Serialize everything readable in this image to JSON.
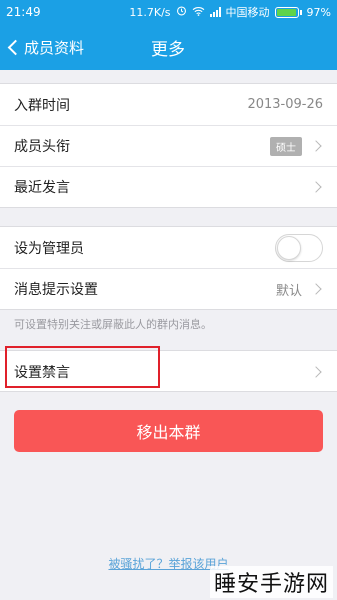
{
  "status_bar": {
    "time": "21:49",
    "speed": "11.7K/s",
    "carrier": "中国移动",
    "battery": "97%",
    "battery_level": 0.97,
    "icons": [
      "alarm-icon",
      "wifi-icon",
      "signal-icon",
      "battery-icon"
    ]
  },
  "nav": {
    "back_label": "成员资料",
    "title": "更多"
  },
  "group1": [
    {
      "label": "入群时间",
      "value": "2013-09-26"
    },
    {
      "label": "成员头衔",
      "badge": "硕士"
    },
    {
      "label": "最近发言"
    }
  ],
  "group2": [
    {
      "label": "设为管理员",
      "toggle_on": false
    },
    {
      "label": "消息提示设置",
      "value": "默认"
    }
  ],
  "hint": "可设置特别关注或屏蔽此人的群内消息。",
  "group3": [
    {
      "label": "设置禁言"
    }
  ],
  "remove_button": "移出本群",
  "report_link": "被骚扰了？举报该用户",
  "watermark": "睡安手游网",
  "colors": {
    "primary": "#1ba0e5",
    "danger": "#f95656",
    "highlight": "#e0202a",
    "link": "#5aa3d8"
  }
}
